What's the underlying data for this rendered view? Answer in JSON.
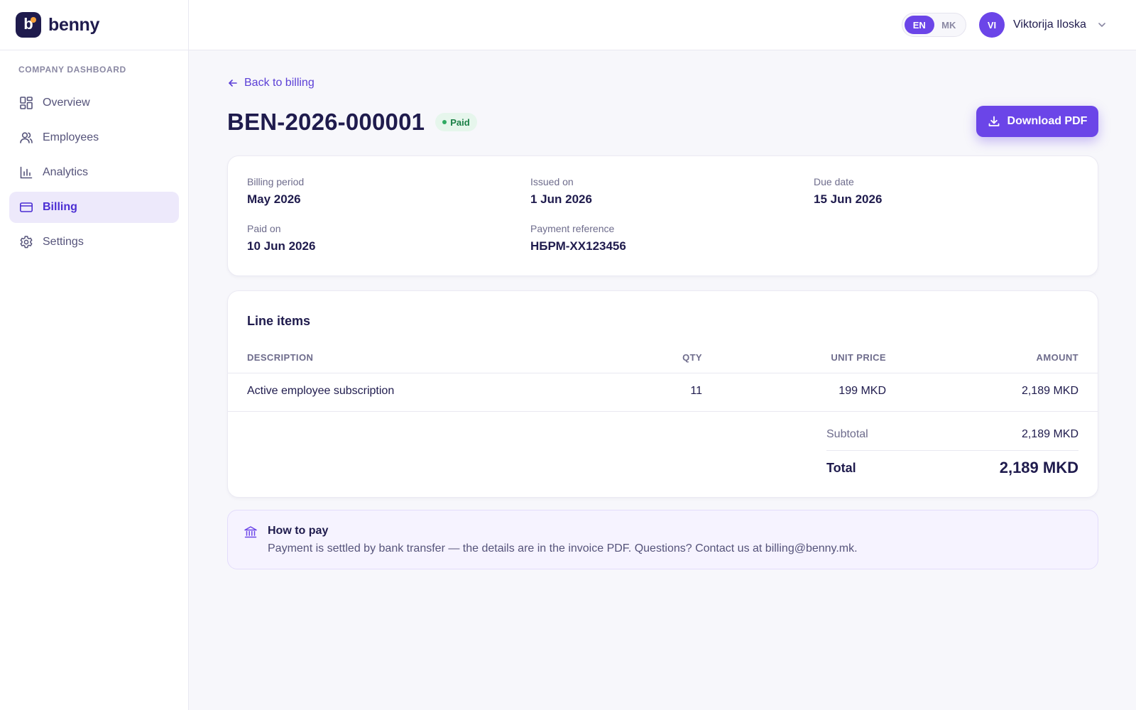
{
  "brand": {
    "name": "benny",
    "logo_letter": "b"
  },
  "sidebar": {
    "section_label": "COMPANY DASHBOARD",
    "items": [
      {
        "label": "Overview",
        "icon": "grid-icon",
        "active": false
      },
      {
        "label": "Employees",
        "icon": "users-icon",
        "active": false
      },
      {
        "label": "Analytics",
        "icon": "bar-chart-icon",
        "active": false
      },
      {
        "label": "Billing",
        "icon": "credit-card-icon",
        "active": true
      },
      {
        "label": "Settings",
        "icon": "gear-icon",
        "active": false
      }
    ]
  },
  "header": {
    "languages": [
      {
        "code": "EN",
        "selected": true
      },
      {
        "code": "MK",
        "selected": false
      }
    ],
    "user": {
      "initials": "VI",
      "name": "Viktorija Iloska"
    }
  },
  "page": {
    "back_link": "Back to billing",
    "invoice_number": "BEN-2026-000001",
    "status": "Paid",
    "download_label": "Download PDF"
  },
  "meta": {
    "billing_period": {
      "label": "Billing period",
      "value": "May 2026"
    },
    "issued_on": {
      "label": "Issued on",
      "value": "1 Jun 2026"
    },
    "due_date": {
      "label": "Due date",
      "value": "15 Jun 2026"
    },
    "paid_on": {
      "label": "Paid on",
      "value": "10 Jun 2026"
    },
    "payment_reference": {
      "label": "Payment reference",
      "value": "НБРМ-XX123456"
    }
  },
  "line_items": {
    "title": "Line items",
    "columns": [
      "DESCRIPTION",
      "QTY",
      "UNIT PRICE",
      "AMOUNT"
    ],
    "rows": [
      {
        "description": "Active employee subscription",
        "qty": "11",
        "unit_price": "199 MKD",
        "amount": "2,189 MKD"
      }
    ],
    "subtotal_label": "Subtotal",
    "subtotal_value": "2,189 MKD",
    "total_label": "Total",
    "total_value": "2,189 MKD"
  },
  "how_to_pay": {
    "title": "How to pay",
    "text": "Payment is settled by bank transfer — the details are in the invoice PDF. Questions? Contact us at billing@benny.mk."
  },
  "colors": {
    "accent": "#6b45e8",
    "navy": "#1f1b4d",
    "paid_badge_bg": "#e6f6ec",
    "paid_badge_text": "#1a7f46"
  }
}
